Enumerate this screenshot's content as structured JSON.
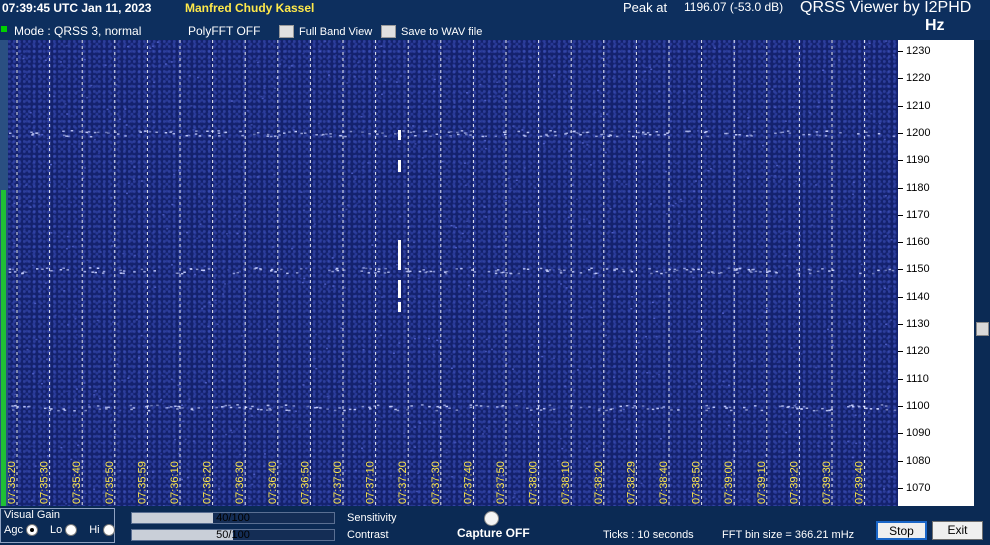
{
  "header": {
    "timestamp": "07:39:45 UTC   Jan 11, 2023",
    "station": "Manfred Chudy Kassel",
    "peak_label": "Peak at",
    "peak_value": "1196.07 (-53.0 dB)",
    "app_title": "QRSS Viewer by I2PHD",
    "hz_unit": "Hz"
  },
  "controls": {
    "mode": "Mode : QRSS 3, normal",
    "polyfft": "PolyFFT OFF",
    "full_band_view": "Full Band View",
    "save_to_wav": "Save to WAV file"
  },
  "freq_scale": [
    {
      "label": "1230"
    },
    {
      "label": "1220"
    },
    {
      "label": "1210"
    },
    {
      "label": "1200"
    },
    {
      "label": "1190"
    },
    {
      "label": "1180"
    },
    {
      "label": "1170"
    },
    {
      "label": "1160"
    },
    {
      "label": "1150"
    },
    {
      "label": "1140"
    },
    {
      "label": "1130"
    },
    {
      "label": "1120"
    },
    {
      "label": "1110"
    },
    {
      "label": "1100"
    },
    {
      "label": "1090"
    },
    {
      "label": "1080"
    },
    {
      "label": "1070"
    }
  ],
  "time_markers": [
    {
      "label": "07:35:20"
    },
    {
      "label": "07:35:30"
    },
    {
      "label": "07:35:40"
    },
    {
      "label": "07:35:50"
    },
    {
      "label": "07:35:59"
    },
    {
      "label": "07:36:10"
    },
    {
      "label": "07:36:20"
    },
    {
      "label": "07:36:30"
    },
    {
      "label": "07:36:40"
    },
    {
      "label": "07:36:50"
    },
    {
      "label": "07:37:00"
    },
    {
      "label": "07:37:10"
    },
    {
      "label": "07:37:20"
    },
    {
      "label": "07:37:30"
    },
    {
      "label": "07:37:40"
    },
    {
      "label": "07:37:50"
    },
    {
      "label": "07:38:00"
    },
    {
      "label": "07:38:10"
    },
    {
      "label": "07:38:20"
    },
    {
      "label": "07:38:29"
    },
    {
      "label": "07:38:40"
    },
    {
      "label": "07:38:50"
    },
    {
      "label": "07:39:00"
    },
    {
      "label": "07:39:10"
    },
    {
      "label": "07:39:20"
    },
    {
      "label": "07:39:30"
    },
    {
      "label": "07:39:40"
    }
  ],
  "visual_gain": {
    "title": "Visual Gain",
    "agc_label": "Agc",
    "lo_label": "Lo",
    "hi_label": "Hi",
    "selected": "Agc"
  },
  "sensitivity": {
    "label": "Sensitivity",
    "value_text": "40/100",
    "value": 40
  },
  "contrast": {
    "label": "Contrast",
    "value_text": "50/100",
    "value": 50
  },
  "capture": {
    "label": "Capture OFF"
  },
  "status": {
    "ticks": "Ticks   : 10 seconds",
    "fft_bin": "FFT bin size = 366.21 mHz"
  },
  "buttons": {
    "stop": "Stop",
    "exit": "Exit"
  },
  "colors": {
    "waterfall_bg": "#14226e",
    "signal": "#ffffff",
    "station_text": "#ffe94a",
    "time_label": "#ffe94a"
  }
}
